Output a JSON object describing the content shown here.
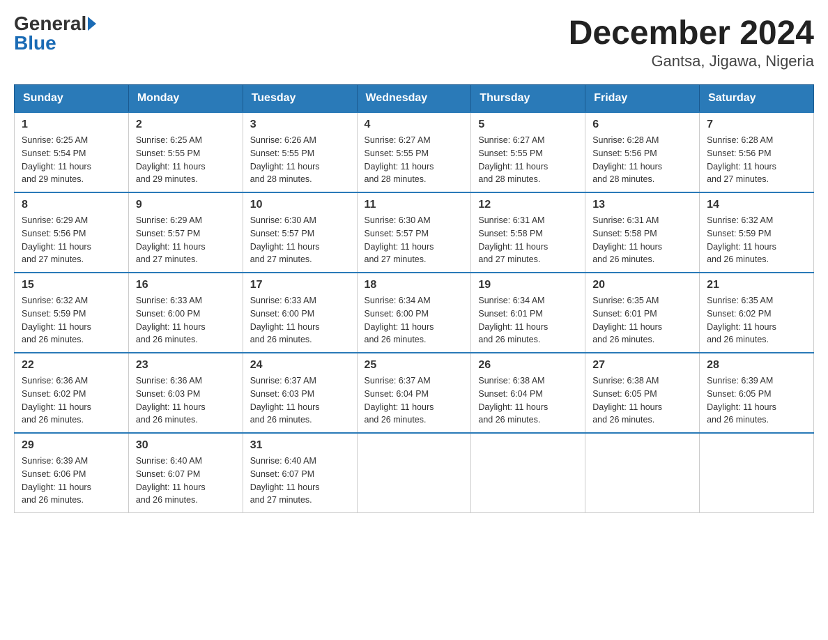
{
  "header": {
    "logo_general": "General",
    "logo_blue": "Blue",
    "title": "December 2024",
    "subtitle": "Gantsa, Jigawa, Nigeria"
  },
  "days_of_week": [
    "Sunday",
    "Monday",
    "Tuesday",
    "Wednesday",
    "Thursday",
    "Friday",
    "Saturday"
  ],
  "weeks": [
    [
      {
        "day": "1",
        "sunrise": "6:25 AM",
        "sunset": "5:54 PM",
        "daylight": "11 hours and 29 minutes."
      },
      {
        "day": "2",
        "sunrise": "6:25 AM",
        "sunset": "5:55 PM",
        "daylight": "11 hours and 29 minutes."
      },
      {
        "day": "3",
        "sunrise": "6:26 AM",
        "sunset": "5:55 PM",
        "daylight": "11 hours and 28 minutes."
      },
      {
        "day": "4",
        "sunrise": "6:27 AM",
        "sunset": "5:55 PM",
        "daylight": "11 hours and 28 minutes."
      },
      {
        "day": "5",
        "sunrise": "6:27 AM",
        "sunset": "5:55 PM",
        "daylight": "11 hours and 28 minutes."
      },
      {
        "day": "6",
        "sunrise": "6:28 AM",
        "sunset": "5:56 PM",
        "daylight": "11 hours and 28 minutes."
      },
      {
        "day": "7",
        "sunrise": "6:28 AM",
        "sunset": "5:56 PM",
        "daylight": "11 hours and 27 minutes."
      }
    ],
    [
      {
        "day": "8",
        "sunrise": "6:29 AM",
        "sunset": "5:56 PM",
        "daylight": "11 hours and 27 minutes."
      },
      {
        "day": "9",
        "sunrise": "6:29 AM",
        "sunset": "5:57 PM",
        "daylight": "11 hours and 27 minutes."
      },
      {
        "day": "10",
        "sunrise": "6:30 AM",
        "sunset": "5:57 PM",
        "daylight": "11 hours and 27 minutes."
      },
      {
        "day": "11",
        "sunrise": "6:30 AM",
        "sunset": "5:57 PM",
        "daylight": "11 hours and 27 minutes."
      },
      {
        "day": "12",
        "sunrise": "6:31 AM",
        "sunset": "5:58 PM",
        "daylight": "11 hours and 27 minutes."
      },
      {
        "day": "13",
        "sunrise": "6:31 AM",
        "sunset": "5:58 PM",
        "daylight": "11 hours and 26 minutes."
      },
      {
        "day": "14",
        "sunrise": "6:32 AM",
        "sunset": "5:59 PM",
        "daylight": "11 hours and 26 minutes."
      }
    ],
    [
      {
        "day": "15",
        "sunrise": "6:32 AM",
        "sunset": "5:59 PM",
        "daylight": "11 hours and 26 minutes."
      },
      {
        "day": "16",
        "sunrise": "6:33 AM",
        "sunset": "6:00 PM",
        "daylight": "11 hours and 26 minutes."
      },
      {
        "day": "17",
        "sunrise": "6:33 AM",
        "sunset": "6:00 PM",
        "daylight": "11 hours and 26 minutes."
      },
      {
        "day": "18",
        "sunrise": "6:34 AM",
        "sunset": "6:00 PM",
        "daylight": "11 hours and 26 minutes."
      },
      {
        "day": "19",
        "sunrise": "6:34 AM",
        "sunset": "6:01 PM",
        "daylight": "11 hours and 26 minutes."
      },
      {
        "day": "20",
        "sunrise": "6:35 AM",
        "sunset": "6:01 PM",
        "daylight": "11 hours and 26 minutes."
      },
      {
        "day": "21",
        "sunrise": "6:35 AM",
        "sunset": "6:02 PM",
        "daylight": "11 hours and 26 minutes."
      }
    ],
    [
      {
        "day": "22",
        "sunrise": "6:36 AM",
        "sunset": "6:02 PM",
        "daylight": "11 hours and 26 minutes."
      },
      {
        "day": "23",
        "sunrise": "6:36 AM",
        "sunset": "6:03 PM",
        "daylight": "11 hours and 26 minutes."
      },
      {
        "day": "24",
        "sunrise": "6:37 AM",
        "sunset": "6:03 PM",
        "daylight": "11 hours and 26 minutes."
      },
      {
        "day": "25",
        "sunrise": "6:37 AM",
        "sunset": "6:04 PM",
        "daylight": "11 hours and 26 minutes."
      },
      {
        "day": "26",
        "sunrise": "6:38 AM",
        "sunset": "6:04 PM",
        "daylight": "11 hours and 26 minutes."
      },
      {
        "day": "27",
        "sunrise": "6:38 AM",
        "sunset": "6:05 PM",
        "daylight": "11 hours and 26 minutes."
      },
      {
        "day": "28",
        "sunrise": "6:39 AM",
        "sunset": "6:05 PM",
        "daylight": "11 hours and 26 minutes."
      }
    ],
    [
      {
        "day": "29",
        "sunrise": "6:39 AM",
        "sunset": "6:06 PM",
        "daylight": "11 hours and 26 minutes."
      },
      {
        "day": "30",
        "sunrise": "6:40 AM",
        "sunset": "6:07 PM",
        "daylight": "11 hours and 26 minutes."
      },
      {
        "day": "31",
        "sunrise": "6:40 AM",
        "sunset": "6:07 PM",
        "daylight": "11 hours and 27 minutes."
      },
      null,
      null,
      null,
      null
    ]
  ],
  "labels": {
    "sunrise": "Sunrise:",
    "sunset": "Sunset:",
    "daylight": "Daylight:"
  },
  "colors": {
    "header_bg": "#2a7ab8",
    "header_text": "#ffffff",
    "border": "#aaaaaa",
    "week_border": "#2a7ab8"
  }
}
